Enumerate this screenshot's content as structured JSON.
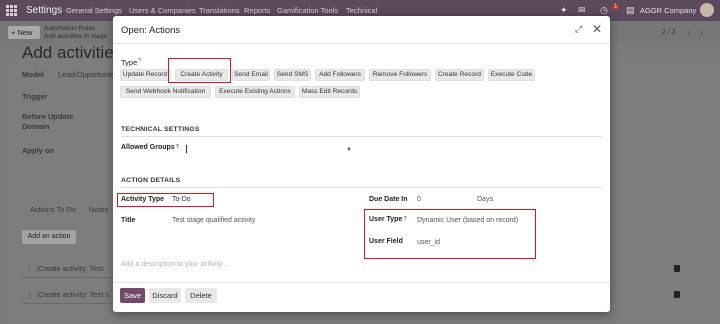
{
  "navbar": {
    "brand": "Settings",
    "menu": [
      "General Settings",
      "Users & Companies",
      "Translations",
      "Reports",
      "Gamification Tools",
      "Technical"
    ],
    "company": "AGGR Company",
    "badge": "1"
  },
  "control_panel": {
    "new_label": "+ New",
    "breadcrumb_parent": "Automation Rules",
    "breadcrumb_current": "Add activities in stage",
    "pager": "2 / 2"
  },
  "background_form": {
    "title": "Add activities t",
    "labels": {
      "model": "Model",
      "model_value": "Lead/Opportunity",
      "trigger": "Trigger",
      "before_update": "Before Update",
      "domain": "Domain",
      "apply_on": "Apply on"
    },
    "tabs": {
      "actions_to_do": "Actions To Do",
      "notes": "Notes"
    },
    "add_action": "Add an action",
    "rows": [
      "Create activity: Test",
      "Create activity: Test s"
    ]
  },
  "modal": {
    "title": "Open: Actions",
    "type_label": "Type",
    "help_mark": "?",
    "type_options": [
      "Update Record",
      "Create Activity",
      "Send Email",
      "Send SMS",
      "Add Followers",
      "Remove Followers",
      "Create Record",
      "Execute Code",
      "Send Webhook Notification",
      "Execute Existing Actions",
      "Mass Edit Records"
    ],
    "technical_settings": {
      "heading": "TECHNICAL SETTINGS",
      "allowed_groups_label": "Allowed Groups"
    },
    "action_details": {
      "heading": "ACTION DETAILS",
      "activity_type_label": "Activity Type",
      "activity_type_value": "To-Do",
      "title_label": "Title",
      "title_value": "Test stage qualified activity",
      "due_date_label": "Due Date In",
      "due_date_value": "0",
      "due_date_unit": "Days",
      "user_type_label": "User Type",
      "user_type_value": "Dynamic User (based on record)",
      "user_field_label": "User Field",
      "user_field_value": "user_id",
      "description_placeholder": "Add a description to your activity..."
    },
    "footer": {
      "save": "Save",
      "discard": "Discard",
      "delete": "Delete"
    }
  },
  "colors": {
    "primary": "#714b67",
    "navbar": "#5b4a5b",
    "highlight": "#e0151b"
  }
}
